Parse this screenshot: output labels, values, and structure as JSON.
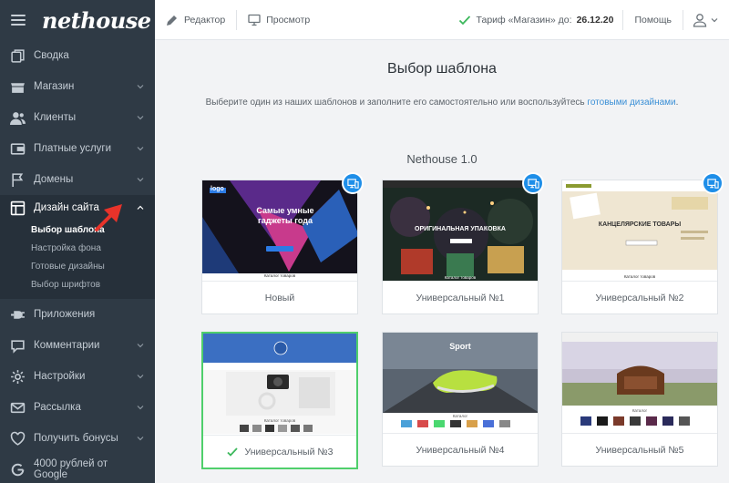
{
  "app": {
    "logo": "nethouse"
  },
  "topbar": {
    "editor_label": "Редактор",
    "preview_label": "Просмотр",
    "tariff_label": "Тариф «Магазин» до:",
    "tariff_date": "26.12.20",
    "help_label": "Помощь"
  },
  "sidebar": {
    "items": [
      {
        "label": "Сводка",
        "icon": "copy-icon"
      },
      {
        "label": "Магазин",
        "icon": "store-icon"
      },
      {
        "label": "Клиенты",
        "icon": "users-icon"
      },
      {
        "label": "Платные услуги",
        "icon": "wallet-icon"
      },
      {
        "label": "Домены",
        "icon": "flag-icon"
      },
      {
        "label": "Дизайн сайта",
        "icon": "layout-icon"
      },
      {
        "label": "Приложения",
        "icon": "plug-icon"
      },
      {
        "label": "Комментарии",
        "icon": "chat-icon"
      },
      {
        "label": "Настройки",
        "icon": "gear-icon"
      },
      {
        "label": "Рассылка",
        "icon": "mail-icon"
      },
      {
        "label": "Получить бонусы",
        "icon": "heart-icon"
      },
      {
        "label": "4000 рублей от Google",
        "icon": "google-icon"
      }
    ],
    "design_sub": [
      "Выбор шаблона",
      "Настройка фона",
      "Готовые дизайны",
      "Выбор шрифтов"
    ]
  },
  "main": {
    "title": "Выбор шаблона",
    "desc_text": "Выберите один из наших шаблонов и заполните его самостоятельно или воспользуйтесь",
    "desc_link": "готовыми дизайнами",
    "desc_end": ".",
    "section": "Nethouse 1.0",
    "templates": [
      {
        "name": "Новый",
        "thumb_title": "Самые умные гаджеты года",
        "thumb_logo": "logo",
        "thumb_footer": "Каталог товаров"
      },
      {
        "name": "Универсальный №1",
        "thumb_title": "ОРИГИНАЛЬНАЯ УПАКОВКА",
        "thumb_footer": "Каталог товаров"
      },
      {
        "name": "Универсальный №2",
        "thumb_title": "КАНЦЕЛЯРСКИЕ ТОВАРЫ",
        "thumb_footer": "Каталог товаров"
      },
      {
        "name": "Универсальный №3",
        "thumb_footer": "Каталог товаров"
      },
      {
        "name": "Универсальный №4",
        "thumb_title": "Sport",
        "thumb_footer": "Каталог"
      },
      {
        "name": "Универсальный №5",
        "thumb_footer": "Каталог"
      }
    ]
  },
  "colors": {
    "sidebar_bg": "#2f3a45",
    "accent_blue": "#1e8ee8",
    "selected_green": "#4fcf6b",
    "annotation_red": "#e8332a"
  }
}
